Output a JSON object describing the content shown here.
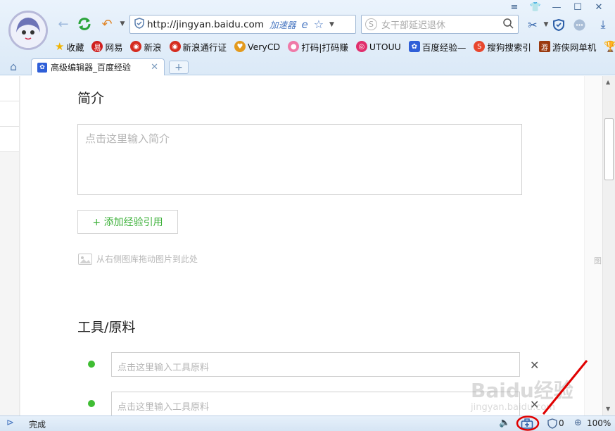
{
  "window": {
    "controls": [
      "≡",
      "👕",
      "—",
      "☐",
      "✕"
    ]
  },
  "toolbar": {
    "url": "http://jingyan.baidu.com",
    "accelerator_label": "加速器",
    "search_placeholder": "女干部延迟退休"
  },
  "favorites": [
    {
      "label": "收藏",
      "color": "#f0b400"
    },
    {
      "label": "网易",
      "color": "#d0201f"
    },
    {
      "label": "新浪",
      "color": "#d52b1e"
    },
    {
      "label": "新浪通行证",
      "color": "#d52b1e"
    },
    {
      "label": "VeryCD",
      "color": "#e39a1d"
    },
    {
      "label": "打码|打码赚",
      "color": "#ef7aa8"
    },
    {
      "label": "UTOUU",
      "color": "#e02e6c"
    },
    {
      "label": "百度经验—",
      "color": "#2f5fd8"
    },
    {
      "label": "搜狗搜索引",
      "color": "#e8462d"
    },
    {
      "label": "游侠网单机",
      "color": "#9a3a10"
    }
  ],
  "tabs": [
    {
      "label": "高级编辑器_百度经验",
      "active": true
    }
  ],
  "page": {
    "intro_heading": "简介",
    "intro_placeholder": "点击这里输入简介",
    "add_ref_label": "+ 添加经验引用",
    "drag_hint": "从右侧图库拖动图片到此处",
    "tools_heading": "工具/原料",
    "tool_placeholders": [
      "点击这里输入工具原料",
      "点击这里输入工具原料"
    ],
    "right_strip_char": "图"
  },
  "statusbar": {
    "status_text": "完成",
    "blocked_count": "0",
    "zoom": "100%"
  },
  "watermark": {
    "line1": "Baidu经验",
    "line2": "jingyan.baidu.com"
  },
  "colors": {
    "accent_green": "#3db13a",
    "annotation_red": "#e00000",
    "link_blue": "#2d5fa8"
  }
}
